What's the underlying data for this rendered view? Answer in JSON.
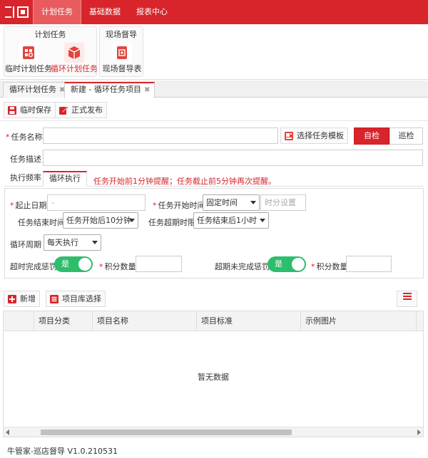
{
  "topnav": [
    "计划任务",
    "基础数据",
    "报表中心"
  ],
  "ribbon": {
    "group1_title": "计划任务",
    "group2_title": "现场督导",
    "items": [
      "临时计划任务",
      "循环计划任务",
      "现场督导表"
    ]
  },
  "doc_tabs": [
    "循环计划任务",
    "新建 - 循环任务项目"
  ],
  "toolbar": {
    "temp_save": "临时保存",
    "publish": "正式发布"
  },
  "form": {
    "task_name_label": "任务名称",
    "task_name_value": "",
    "select_template": "选择任务模板",
    "self_check": "自检",
    "patrol": "巡检",
    "task_desc_label": "任务描述",
    "task_desc_value": ""
  },
  "subtabs": [
    "执行频率",
    "循环执行"
  ],
  "hint": "任务开始前1分钟提醒；任务截止前5分钟再次提醒。",
  "cycle": {
    "date_range_label": "起止日期",
    "date_range_value": "-",
    "start_time_label": "任务开始时间",
    "start_time_mode": "固定时间",
    "time_placeholder": "时分设置",
    "end_time_label": "任务结束时间",
    "end_time_value": "任务开始后10分钟",
    "overdue_limit_label": "任务超期时限",
    "overdue_limit_value": "任务结束后1小时",
    "period_label": "循环周期",
    "period_value": "每天执行",
    "overtime_penalty_label": "超时完成惩罚",
    "overtime_toggle": "是",
    "points_label_1": "积分数量",
    "points_value_1": "",
    "unfinished_penalty_label": "超期未完成惩罚",
    "unfinished_toggle": "是",
    "points_label_2": "积分数量",
    "points_value_2": ""
  },
  "items_toolbar": {
    "add": "新增",
    "library": "项目库选择"
  },
  "table": {
    "columns": [
      "",
      "项目分类",
      "项目名称",
      "项目标准",
      "示例图片"
    ],
    "empty_text": "暂无数据"
  },
  "footer": "牛管家-巡店督导 V1.0.210531",
  "colors": {
    "brand": "#d7252b",
    "toggle_on": "#2dbe6c"
  }
}
